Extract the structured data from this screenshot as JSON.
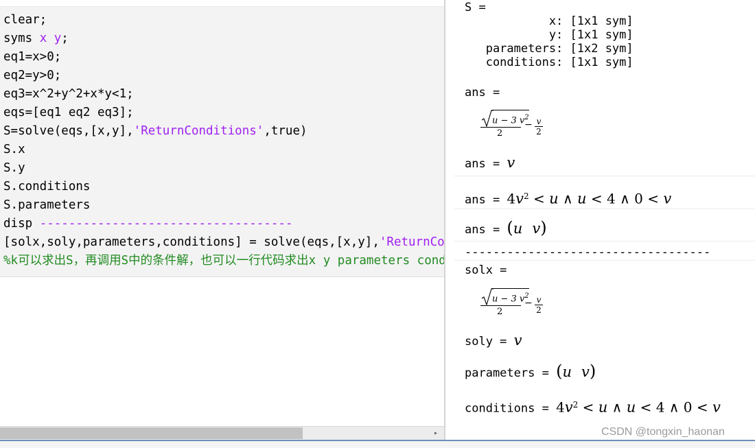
{
  "editor": {
    "lines": [
      {
        "parts": [
          {
            "text": "clear;"
          }
        ]
      },
      {
        "parts": [
          {
            "text": "syms "
          },
          {
            "text": "x y",
            "style": "kw"
          },
          {
            "text": ";"
          }
        ]
      },
      {
        "parts": [
          {
            "text": "eq1=x>0;"
          }
        ]
      },
      {
        "parts": [
          {
            "text": "eq2=y>0;"
          }
        ]
      },
      {
        "parts": [
          {
            "text": "eq3=x^2+y^2+x*y<1;"
          }
        ]
      },
      {
        "parts": [
          {
            "text": "eqs=[eq1 eq2 eq3];"
          }
        ]
      },
      {
        "parts": [
          {
            "text": "S=solve(eqs,[x,y],"
          },
          {
            "text": "'ReturnConditions'",
            "style": "str"
          },
          {
            "text": ",true)"
          }
        ]
      },
      {
        "parts": [
          {
            "text": "S.x"
          }
        ]
      },
      {
        "parts": [
          {
            "text": "S.y"
          }
        ]
      },
      {
        "parts": [
          {
            "text": "S.conditions"
          }
        ]
      },
      {
        "parts": [
          {
            "text": "S.parameters"
          }
        ]
      },
      {
        "parts": [
          {
            "text": "disp "
          },
          {
            "text": "-----------------------------------",
            "style": "str"
          }
        ]
      },
      {
        "parts": [
          {
            "text": "[solx,soly,parameters,conditions] = solve(eqs,[x,y],"
          },
          {
            "text": "'ReturnCondi",
            "style": "str"
          }
        ]
      },
      {
        "parts": [
          {
            "text": "%k可以求出S，再调用S中的条件解，也可以一行代码求出x y parameters conditions",
            "style": "cmt"
          }
        ]
      }
    ]
  },
  "output": {
    "s_header": "S =",
    "s_fields": [
      "            x: [1x1 sym]",
      "            y: [1x1 sym]",
      "   parameters: [1x2 sym]",
      "   conditions: [1x1 sym]"
    ],
    "ans_label": "ans =",
    "sqrt_radicand": "u − 3 v",
    "sqrt_exp": "2",
    "frac_den": "2",
    "minus": "−",
    "v_num": "v",
    "v_den": "2",
    "ans_prefix": "ans = ",
    "ans_v": "v",
    "cond_4": "4",
    "cond_v": "v",
    "cond_sq": "2",
    "cond_rest1": " < ",
    "cond_u1": "u",
    "cond_and1": " ∧ ",
    "cond_u2": "u",
    "cond_rest2": " < 4 ∧ 0 < ",
    "cond_v2": "v",
    "params_open": "(",
    "params_u": "u",
    "params_v": "v",
    "params_close": ")",
    "dash_line": "-----------------------------------",
    "solx_label": "solx =",
    "soly_prefix": "soly = ",
    "soly_v": "v",
    "parameters_prefix": "parameters = ",
    "conditions_prefix": "conditions = "
  },
  "watermark": "CSDN @tongxin_haonan"
}
